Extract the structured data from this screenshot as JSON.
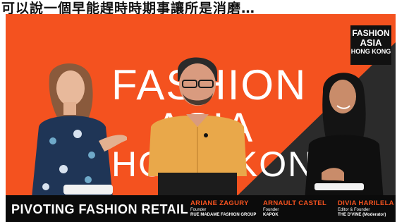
{
  "caption_strip": {
    "text": "可以說一個早能趕時時期事讓所是消磨…"
  },
  "backdrop": {
    "lines": [
      "FASHION",
      "ASIA",
      "HONG KONG"
    ],
    "color": "#f4521f"
  },
  "logo": {
    "line1": "FASHION",
    "line2": "ASIA",
    "line3": "HONG KONG"
  },
  "lower_third": {
    "title": "PIVOTING FASHION RETAIL",
    "speakers": [
      {
        "name": "ARIANE ZAGURY",
        "role": "Founder",
        "org": "RUE MADAME FASHION GROUP"
      },
      {
        "name": "ARNAULT CASTEL",
        "role": "Founder",
        "org": "KAPOK"
      },
      {
        "name": "DIVIA HARILELA",
        "role": "Editor & Founder",
        "org": "THE D'VINE (Moderator)"
      }
    ]
  }
}
